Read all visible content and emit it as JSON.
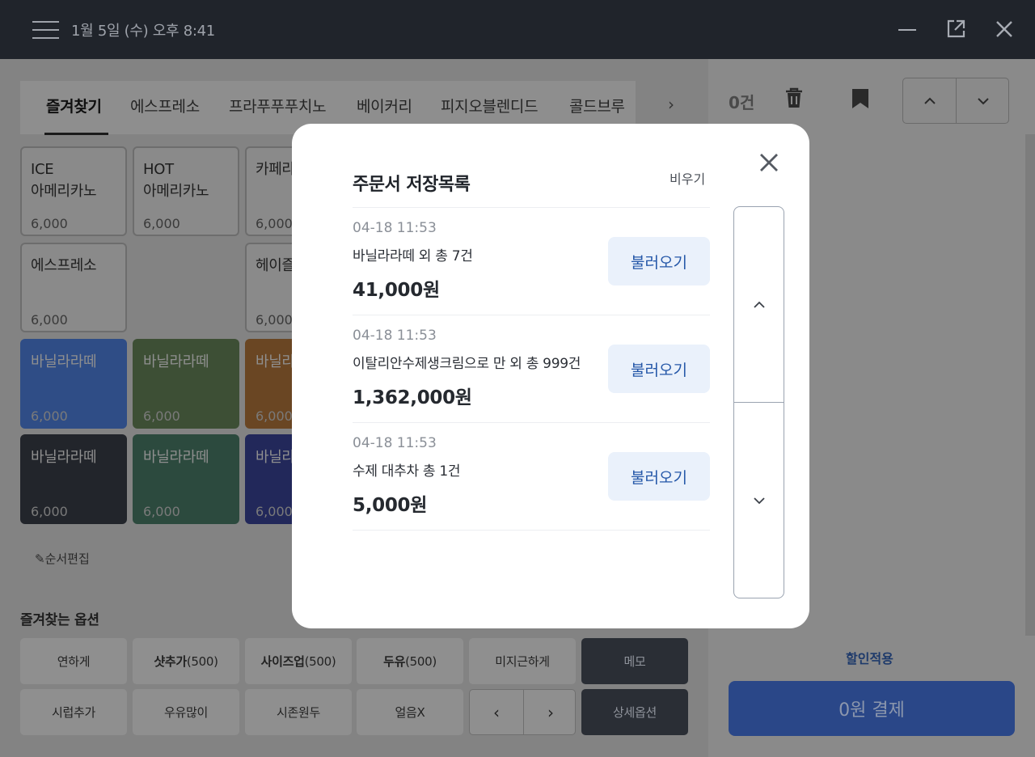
{
  "titlebar": {
    "datetime": "1월 5일 (수) 오후 8:41"
  },
  "categories": [
    {
      "label": "즐겨찾기",
      "active": true
    },
    {
      "label": "에스프레소"
    },
    {
      "label": "프라푸푸푸치노"
    },
    {
      "label": "베이커리"
    },
    {
      "label": "피지오블렌디드"
    },
    {
      "label": "콜드브루"
    }
  ],
  "menu_tiles": [
    {
      "name": "ICE\n아메리카노",
      "price": "6,000"
    },
    {
      "name": "HOT\n아메리카노",
      "price": "6,000"
    },
    {
      "name": "카페라",
      "price": "6,000"
    },
    {
      "name": "에스프레소",
      "price": "6,000"
    },
    {
      "name": "헤이즐",
      "price": "6,000"
    },
    {
      "name": "바닐라라떼",
      "price": "6,000",
      "color": "#2f4d86"
    },
    {
      "name": "바닐라라떼",
      "price": "6,000",
      "color": "#3d4f35"
    },
    {
      "name": "바닐라",
      "price": "6,000",
      "color": "#6a4623"
    },
    {
      "name": "바닐라라떼",
      "price": "6,000",
      "color": "#22252b"
    },
    {
      "name": "바닐라라떼",
      "price": "6,000",
      "color": "#2c4a3e"
    },
    {
      "name": "바닐라",
      "price": "6,000",
      "color": "#22285a"
    }
  ],
  "edit_order_label": "순서편집",
  "favorites": {
    "title": "즐겨찾는 옵션",
    "options": [
      {
        "label": "연하게"
      },
      {
        "label": "샷추가",
        "suffix": " (500)"
      },
      {
        "label": "사이즈업",
        "suffix": " (500)"
      },
      {
        "label": "두유",
        "suffix": "(500)"
      },
      {
        "label": "미지근하게"
      },
      {
        "label": "메모"
      },
      {
        "label": "시럽추가"
      },
      {
        "label": "우유많이"
      },
      {
        "label": "시존원두"
      },
      {
        "label": "얼음X"
      },
      {
        "label": "상세옵션"
      }
    ]
  },
  "right_panel": {
    "count": "0건",
    "discount": "할인적용",
    "pay": "0원 결제"
  },
  "modal": {
    "title": "주문서 저장목록",
    "clear": "비우기",
    "orders": [
      {
        "time": "04-18 11:53",
        "desc": "바닐라라떼 외 총 7건",
        "amount": "41,000원",
        "load": "불러오기"
      },
      {
        "time": "04-18 11:53",
        "desc": "이탈리안수제생크림으로 만 외 총 999건",
        "amount": "1,362,000원",
        "load": "불러오기"
      },
      {
        "time": "04-18 11:53",
        "desc": "수제 대추차 총 1건",
        "amount": "5,000원",
        "load": "불러오기"
      }
    ]
  },
  "colors": {
    "accent_blue": "#2457a8",
    "load_bg": "#eaf1fb",
    "titlebar": "#20242b"
  }
}
